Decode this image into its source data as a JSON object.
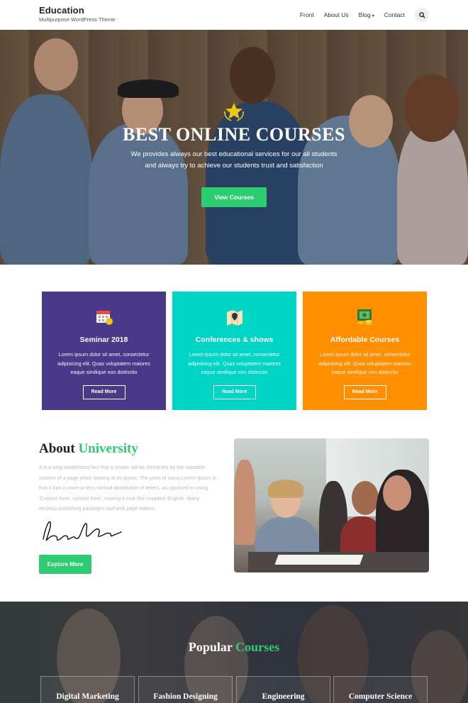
{
  "brand": {
    "name": "Education",
    "tagline": "Multipurpose WordPress Theme"
  },
  "nav": {
    "items": [
      "Front",
      "About Us",
      "Blog",
      "Contact"
    ],
    "blog_caret": "▾",
    "search_icon": "search-icon"
  },
  "hero": {
    "title": "BEST ONLINE COURSES",
    "subtitle_line1": "We provides always our best educational services for our all students",
    "subtitle_line2": "and always try to achieve our students trust and satisfaction",
    "button": "View Courses"
  },
  "features": [
    {
      "title": "Seminar 2018",
      "text": "Lorem ipsum dolor sit amet, consectetur adipisicing elit. Quas voluptatem maiores eaque similique non distinctio",
      "button": "Read More",
      "color": "#4a3889",
      "icon": "calendar-icon"
    },
    {
      "title": "Conferences & shows",
      "text": "Lorem ipsum dolor sit amet, consectetur adipisicing elit. Quas voluptatem maiores eaque similique non distinctio",
      "button": "Read More",
      "color": "#00d4c4",
      "icon": "map-icon"
    },
    {
      "title": "Affordable Courses",
      "text": "Lorem ipsum dolor sit amet, consectetur adipisicing elit. Quas voluptatem maiores eaque similique non distinctio",
      "button": "Read More",
      "color": "#ff8f00",
      "icon": "money-icon"
    }
  ],
  "about": {
    "title_plain": "About ",
    "title_accent": "University",
    "text": "It is a long established fact that a reader will be distracted by the readable content of a page when looking at its layout. The point of using Lorem Ipsum is that it has a more-or-less normal distribution of letters, as opposed to using 'Content here, content here', making it look like readable English. Many desktop publishing packages and web page editors.",
    "button": "Explore More"
  },
  "popular": {
    "title_plain": "Popular ",
    "title_accent": "Courses",
    "courses": [
      "Digital Marketing",
      "Fashion Designing",
      "Engineering",
      "Computer Science"
    ]
  },
  "colors": {
    "accent": "#2ecc71"
  }
}
